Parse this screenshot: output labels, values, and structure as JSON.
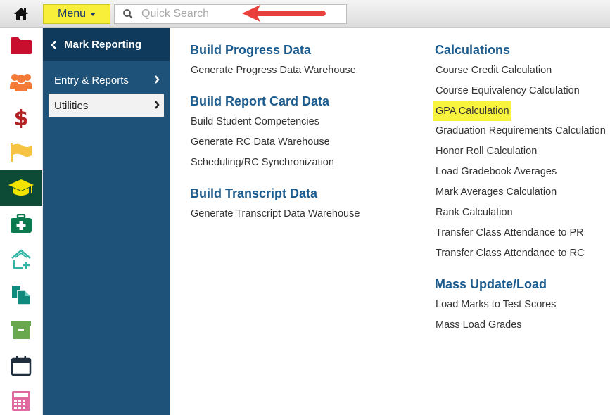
{
  "topbar": {
    "menu_label": "Menu",
    "search_placeholder": "Quick Search"
  },
  "rail": {
    "items": [
      {
        "icon": "folder-icon",
        "color": "#c8102e"
      },
      {
        "icon": "people-icon",
        "color": "#f47a37"
      },
      {
        "icon": "dollar-icon",
        "color": "#b22222"
      },
      {
        "icon": "flag-icon",
        "color": "#f6c342"
      },
      {
        "icon": "graduation-cap-icon",
        "color": "#f3e400",
        "active": true
      },
      {
        "icon": "medical-kit-icon",
        "color": "#0a7a4f"
      },
      {
        "icon": "house-plus-icon",
        "color": "#33b5a5"
      },
      {
        "icon": "documents-icon",
        "color": "#118a7e"
      },
      {
        "icon": "archive-box-icon",
        "color": "#6aa84f"
      },
      {
        "icon": "calendar-icon",
        "color": "#1f2d3d"
      },
      {
        "icon": "calculator-icon",
        "color": "#e06aa0"
      }
    ]
  },
  "nav": {
    "header": "Mark Reporting",
    "items": [
      {
        "label": "Entry & Reports"
      },
      {
        "label": "Utilities",
        "selected": true
      }
    ]
  },
  "content": {
    "col1": [
      {
        "title": "Build Progress Data",
        "links": [
          "Generate Progress Data Warehouse"
        ]
      },
      {
        "title": "Build Report Card Data",
        "links": [
          "Build Student Competencies",
          "Generate RC Data Warehouse",
          "Scheduling/RC Synchronization"
        ]
      },
      {
        "title": "Build Transcript Data",
        "links": [
          "Generate Transcript Data Warehouse"
        ]
      }
    ],
    "col2": [
      {
        "title": "Calculations",
        "links": [
          "Course Credit Calculation",
          "Course Equivalency Calculation",
          "GPA Calculation",
          "Graduation Requirements Calculation",
          "Honor Roll Calculation",
          "Load Gradebook Averages",
          "Mark Averages Calculation",
          "Rank Calculation",
          "Transfer Class Attendance to PR",
          "Transfer Class Attendance to RC"
        ]
      },
      {
        "title": "Mass Update/Load",
        "links": [
          "Load Marks to Test Scores",
          "Mass Load Grades"
        ]
      }
    ]
  },
  "colors": {
    "accent_yellow": "#f8ef3a",
    "nav_dark": "#1f5278",
    "nav_header": "#0f3a5c",
    "title_blue": "#1b5b8e",
    "arrow_red": "#e8403a"
  }
}
